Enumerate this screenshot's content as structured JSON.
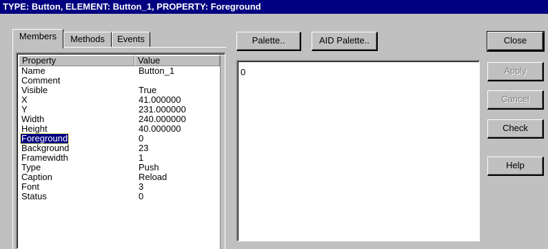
{
  "title": "TYPE: Button,  ELEMENT: Button_1,  PROPERTY: Foreground",
  "tabs": [
    {
      "label": "Members",
      "active": true
    },
    {
      "label": "Methods",
      "active": false
    },
    {
      "label": "Events",
      "active": false
    }
  ],
  "columns": {
    "property": "Property",
    "value": "Value"
  },
  "rows": [
    {
      "property": "Name",
      "value": "Button_1"
    },
    {
      "property": "Comment",
      "value": ""
    },
    {
      "property": "Visible",
      "value": "True"
    },
    {
      "property": "X",
      "value": "41.000000"
    },
    {
      "property": "Y",
      "value": "231.000000"
    },
    {
      "property": "Width",
      "value": "240.000000"
    },
    {
      "property": "Height",
      "value": "40.000000"
    },
    {
      "property": "Foreground",
      "value": "0",
      "selected": true
    },
    {
      "property": "Background",
      "value": "23"
    },
    {
      "property": "Framewidth",
      "value": "1"
    },
    {
      "property": "Type",
      "value": "Push"
    },
    {
      "property": "Caption",
      "value": "Reload"
    },
    {
      "property": "Font",
      "value": "3"
    },
    {
      "property": "Status",
      "value": "0"
    }
  ],
  "toolbar": {
    "palette_label": "Palette..",
    "aid_palette_label": "AID Palette.."
  },
  "editor": {
    "value": "0"
  },
  "side_buttons": {
    "close": "Close",
    "apply": "Apply",
    "cancel": "Cancel",
    "check": "Check",
    "help": "Help"
  },
  "colors": {
    "titlebar": "#000080",
    "face": "#c0c0c0",
    "selection": "#000080"
  }
}
